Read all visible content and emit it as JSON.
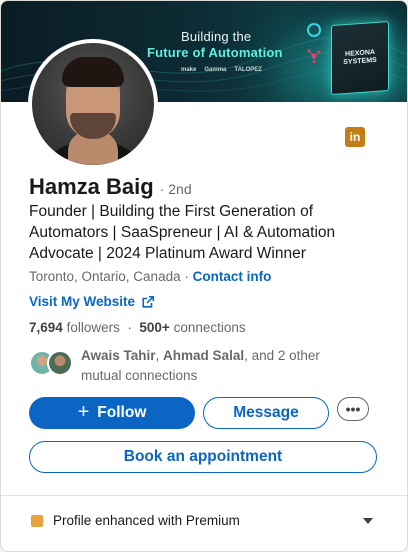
{
  "banner": {
    "title_line1": "Building the",
    "title_line2": "Future of Automation",
    "sponsors": [
      "make",
      "Gamma",
      "TALOPEZ"
    ],
    "box_text_1": "HEXONA",
    "box_text_2": "SYSTEMS"
  },
  "profile": {
    "name": "Hamza Baig",
    "degree": "· 2nd",
    "headline": "Founder | Building the First Generation of Automators | SaaSpreneur | AI & Automation Advocate | 2024 Platinum Award Winner",
    "location": "Toronto, Ontario, Canada",
    "separator": "·",
    "contact_label": "Contact info",
    "website_label": "Visit My Website",
    "followers_count": "7,694",
    "followers_label": "followers",
    "connections_count": "500+",
    "connections_label": "connections",
    "mutual_name_1": "Awais Tahir",
    "mutual_name_2": "Ahmad Salal",
    "mutual_rest": ", and 2 other mutual connections"
  },
  "badge": {
    "label": "in"
  },
  "actions": {
    "follow_label": "Follow",
    "follow_icon": "+",
    "message_label": "Message",
    "more_label": "•••",
    "book_label": "Book an appointment"
  },
  "premium": {
    "label": "Profile enhanced with Premium"
  },
  "colors": {
    "accent": "#0a66c2",
    "premium": "#e7a33e",
    "badge": "#c37d16"
  }
}
